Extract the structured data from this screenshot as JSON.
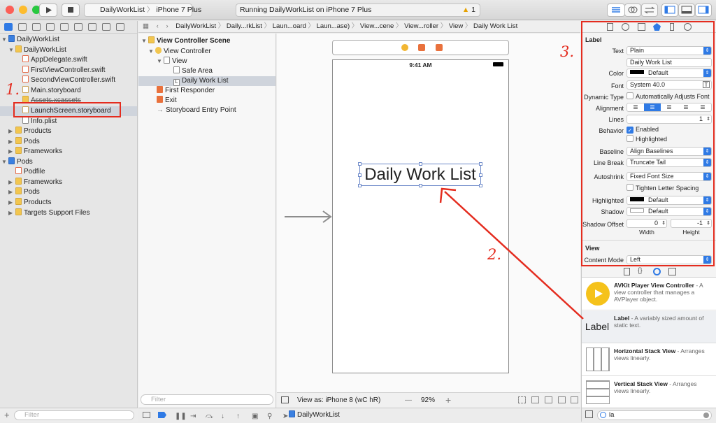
{
  "toolbar": {
    "scheme": "DailyWorkList",
    "device": "iPhone 7 Plus",
    "status": "Running DailyWorkList on iPhone 7 Plus",
    "warning_count": "1"
  },
  "navigator": {
    "root": "DailyWorkList",
    "group": "DailyWorkList",
    "files": [
      "AppDelegate.swift",
      "FirstViewController.swift",
      "SecondViewController.swift",
      "Main.storyboard",
      "Assets.xcassets",
      "LaunchScreen.storyboard",
      "Info.plist"
    ],
    "groups": [
      "Products",
      "Pods",
      "Frameworks"
    ],
    "pods_root": "Pods",
    "pods_items": [
      "Podfile",
      "Frameworks",
      "Pods",
      "Products",
      "Targets Support Files"
    ],
    "filter_placeholder": "Filter"
  },
  "jumpbar": [
    "DailyWorkList",
    "Daily...rkList",
    "Laun...oard",
    "Laun...ase)",
    "View...cene",
    "View...roller",
    "View",
    "Daily Work List"
  ],
  "outline": {
    "scene": "View Controller Scene",
    "controller": "View Controller",
    "view": "View",
    "safe_area": "Safe Area",
    "label": "Daily Work List",
    "first_responder": "First Responder",
    "exit": "Exit",
    "entry": "Storyboard Entry Point",
    "filter_placeholder": "Filter"
  },
  "canvas": {
    "time": "9:41 AM",
    "label_text": "Daily Work List",
    "view_as": "View as: iPhone 8 (wC hR)",
    "zoom": "92%",
    "minus": "—",
    "plus": "+"
  },
  "debug": {
    "target": "DailyWorkList"
  },
  "inspector": {
    "section_label": "Label",
    "text_label": "Text",
    "text_value": "Plain",
    "text_content": "Daily Work List",
    "color_label": "Color",
    "color_value": "Default",
    "font_label": "Font",
    "font_value": "System 40.0",
    "dynamic_label": "Dynamic Type",
    "dynamic_value": "Automatically Adjusts Font",
    "alignment_label": "Alignment",
    "lines_label": "Lines",
    "lines_value": "1",
    "behavior_label": "Behavior",
    "enabled": "Enabled",
    "highlighted": "Highlighted",
    "baseline_label": "Baseline",
    "baseline_value": "Align Baselines",
    "linebreak_label": "Line Break",
    "linebreak_value": "Truncate Tail",
    "autoshrink_label": "Autoshrink",
    "autoshrink_value": "Fixed Font Size",
    "tighten": "Tighten Letter Spacing",
    "hl_label": "Highlighted",
    "hl_value": "Default",
    "shadow_label": "Shadow",
    "shadow_value": "Default",
    "offset_label": "Shadow Offset",
    "offset_w": "0",
    "offset_h": "-1",
    "width": "Width",
    "height": "Height",
    "section_view": "View",
    "mode_label": "Content Mode",
    "mode_value": "Left"
  },
  "library": {
    "items": [
      {
        "title": "AVKit Player View Controller",
        "desc": " - A view controller that manages a AVPlayer object."
      },
      {
        "title": "Label",
        "desc": " - A variably sized amount of static text."
      },
      {
        "title": "Horizontal Stack View",
        "desc": " - Arranges views linearly."
      },
      {
        "title": "Vertical Stack View",
        "desc": " - Arranges views linearly."
      }
    ],
    "label_preview": "Label",
    "search_value": "la"
  },
  "annotations": {
    "one": "1.",
    "two": "2.",
    "three": "3."
  },
  "colors": {
    "accent": "#2f7ae5",
    "annotation": "#e42c1f",
    "selection": "#cfd4dc"
  }
}
